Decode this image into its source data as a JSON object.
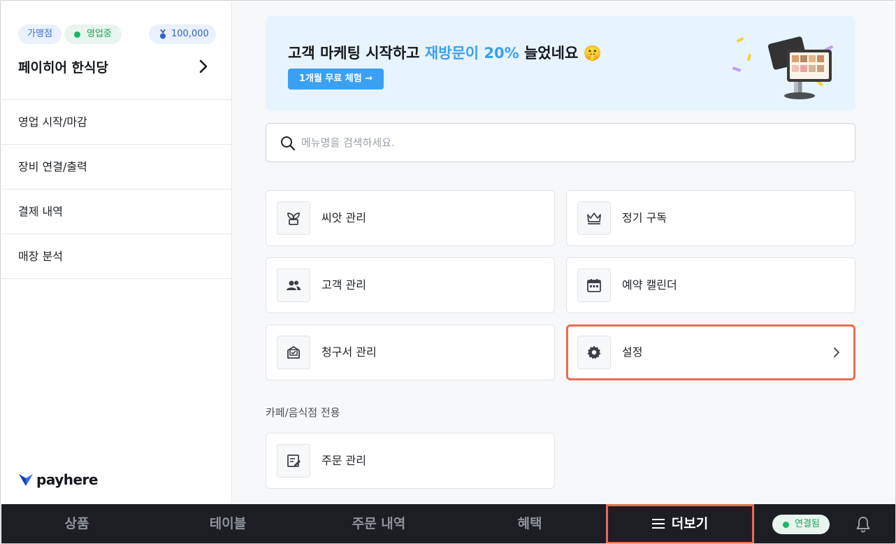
{
  "sidebar": {
    "badges": {
      "franchise": "가맹점",
      "status": "영업중",
      "points": "100,000"
    },
    "store_name": "페이히어 한식당",
    "items": [
      {
        "label": "영업 시작/마감"
      },
      {
        "label": "장비 연결/출력"
      },
      {
        "label": "결제 내역"
      },
      {
        "label": "매장 분석"
      }
    ],
    "logo_text": "payhere"
  },
  "banner": {
    "title_prefix": "고객 마케팅 시작하고 ",
    "title_highlight": "재방문이 20%",
    "title_suffix": " 늘었네요 🤫",
    "cta": "1개월 무료 체험 →"
  },
  "search": {
    "placeholder": "메뉴명을 검색하세요.",
    "value": ""
  },
  "cards": {
    "seed": "씨앗 관리",
    "subscription": "정기 구독",
    "customers": "고객 관리",
    "reservation": "예약 캘린더",
    "invoice": "청구서 관리",
    "settings": "설정",
    "orders": "주문 관리"
  },
  "section_cafe": "카페/음식점 전용",
  "bottom_nav": {
    "tabs": [
      "상품",
      "테이블",
      "주문 내역",
      "혜택",
      "더보기"
    ],
    "connection": "연결됨"
  },
  "colors": {
    "accent": "#3aa0f2",
    "open_green": "#14b866",
    "highlight_outline": "#ec6a55",
    "bottom_bar": "#1c1e23"
  }
}
